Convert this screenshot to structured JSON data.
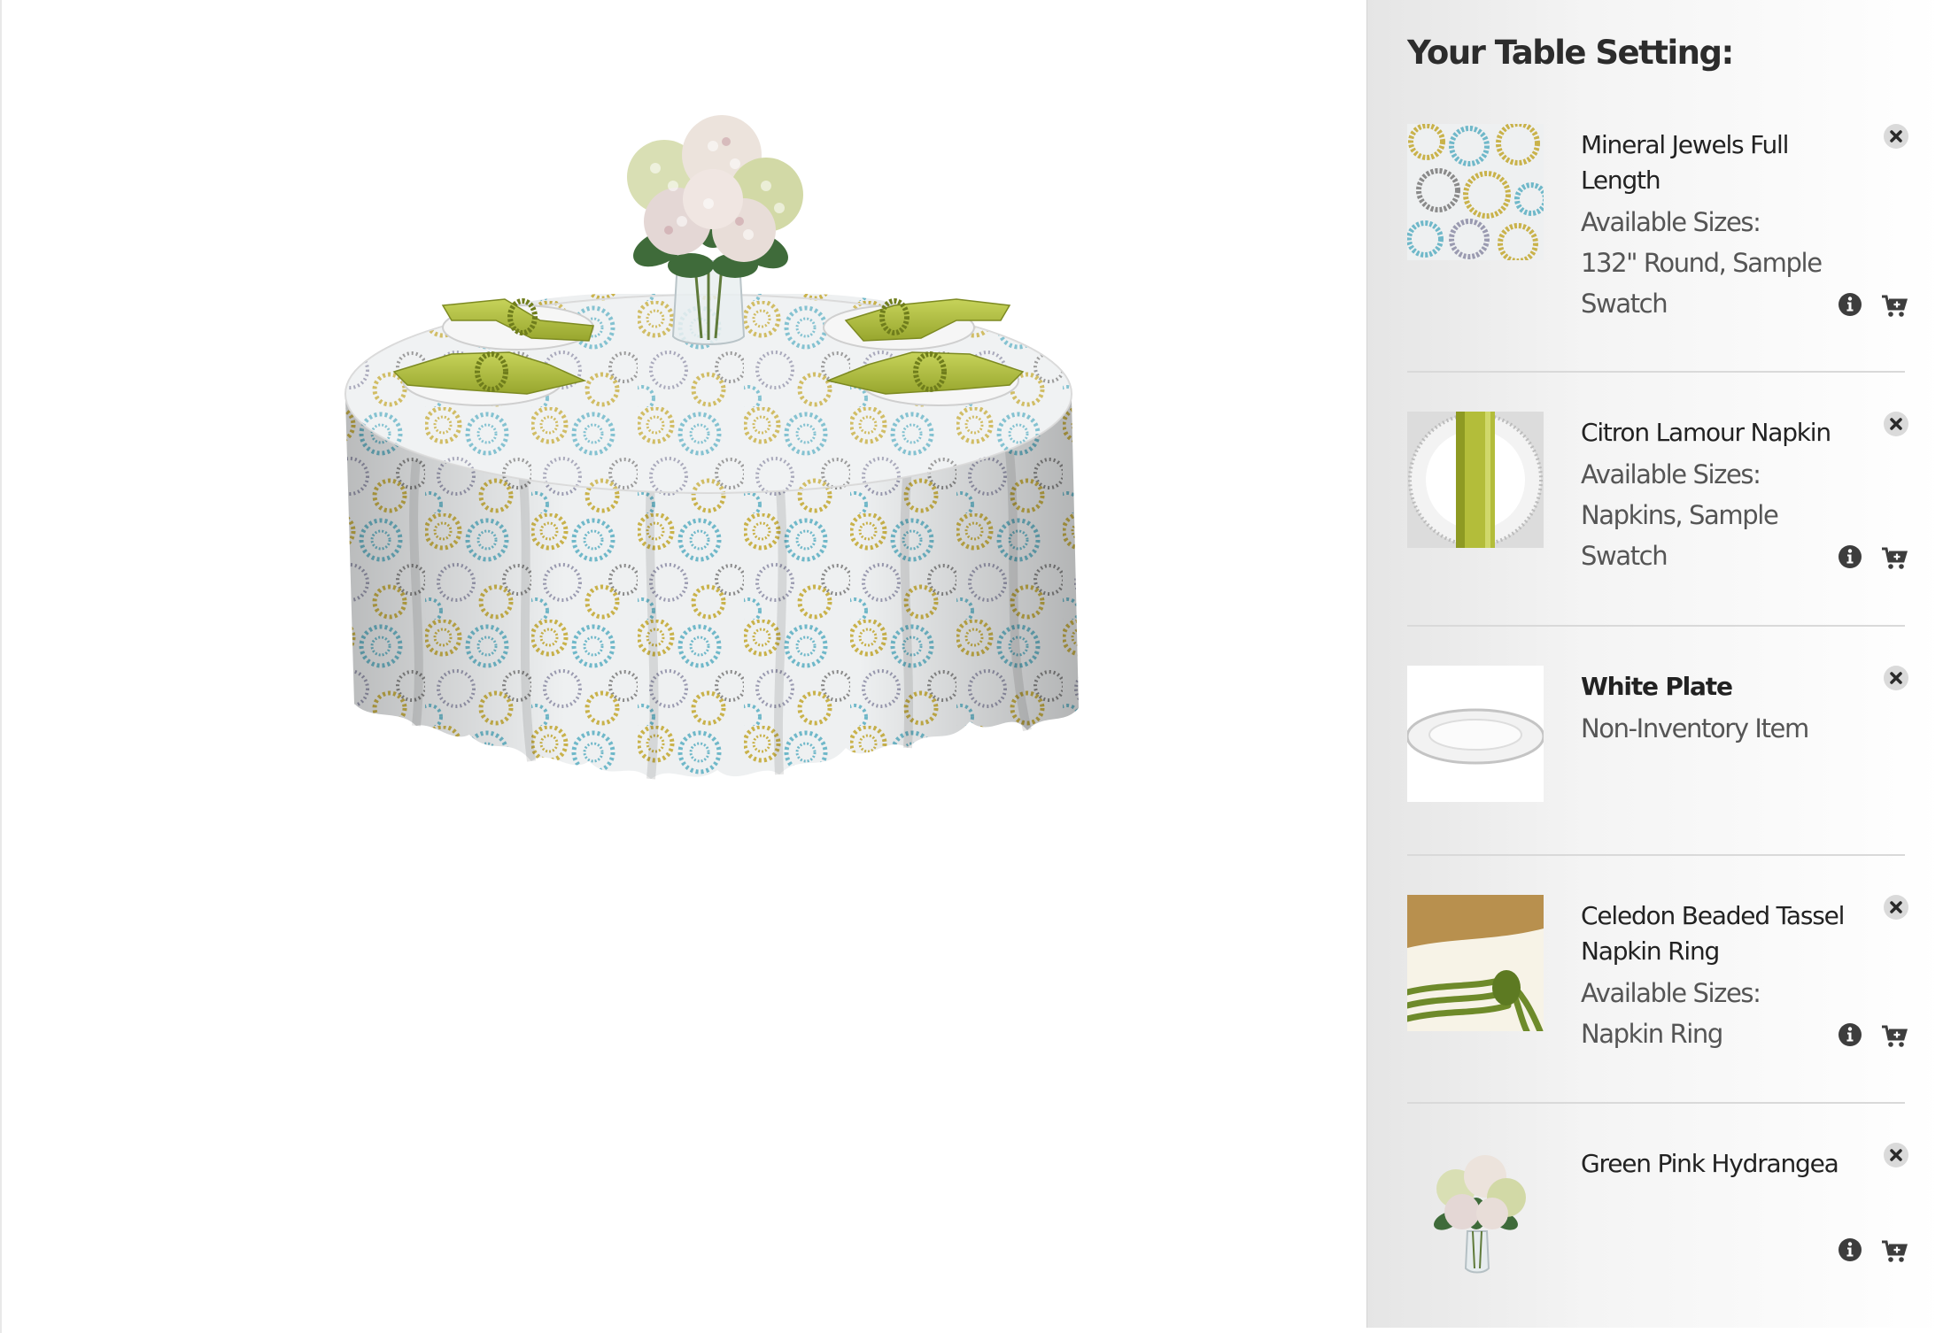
{
  "panel": {
    "title": "Your Table Setting:",
    "items": [
      {
        "name": "Mineral Jewels Full Length",
        "sizes_label": "Available Sizes:",
        "sizes_value": "132\" Round, Sample Swatch",
        "thumb": "mineral-jewels-swatch"
      },
      {
        "name": "Citron Lamour Napkin",
        "sizes_label": "Available Sizes:",
        "sizes_value": "Napkins, Sample Swatch",
        "thumb": "citron-napkin-on-charger"
      },
      {
        "name": "White Plate",
        "note": "Non-Inventory Item",
        "thumb": "white-plate"
      },
      {
        "name": "Celedon Beaded Tassel Napkin Ring",
        "sizes_label": "Available Sizes:",
        "sizes_value": "Napkin Ring",
        "thumb": "beaded-napkin-ring"
      },
      {
        "name": "Green Pink Hydrangea",
        "thumb": "hydrangea-vase"
      }
    ]
  },
  "icons": {
    "remove": "remove-icon",
    "info": "info-icon",
    "cart": "add-to-cart-icon"
  },
  "colors": {
    "panel_background": "#f4f4f4",
    "icon_dark": "#3d3d3d",
    "separator": "#d9d9d9",
    "napkin_green": "#a9b83c"
  }
}
